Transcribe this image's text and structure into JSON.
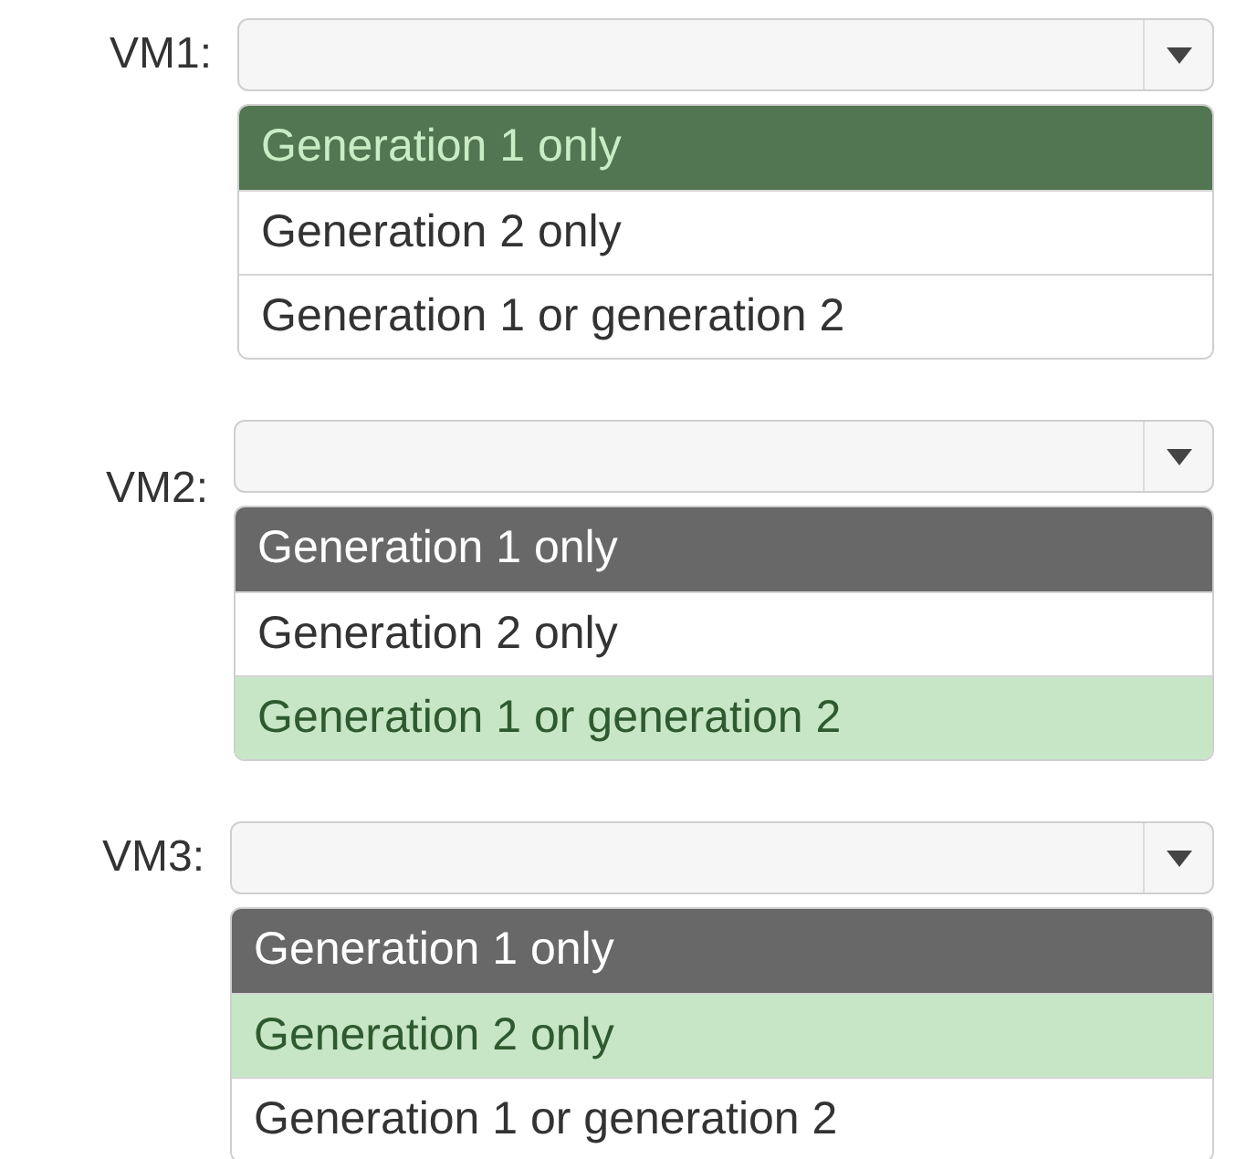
{
  "questions": [
    {
      "label": "VM1:",
      "options": [
        {
          "kind": "header",
          "text": "Generation 1 only",
          "selected": true
        },
        {
          "kind": "option",
          "text": "Generation 2 only",
          "selected": false
        },
        {
          "kind": "option",
          "text": "Generation 1 or generation 2",
          "selected": false
        }
      ]
    },
    {
      "label": "VM2:",
      "options": [
        {
          "kind": "header",
          "text": "Generation 1 only",
          "selected": false
        },
        {
          "kind": "option",
          "text": "Generation 2 only",
          "selected": false
        },
        {
          "kind": "option",
          "text": "Generation 1 or generation 2",
          "selected": true
        }
      ]
    },
    {
      "label": "VM3:",
      "options": [
        {
          "kind": "header",
          "text": "Generation 1 only",
          "selected": false
        },
        {
          "kind": "option",
          "text": "Generation 2 only",
          "selected": true
        },
        {
          "kind": "option",
          "text": "Generation 1 or generation 2",
          "selected": false
        }
      ]
    }
  ]
}
